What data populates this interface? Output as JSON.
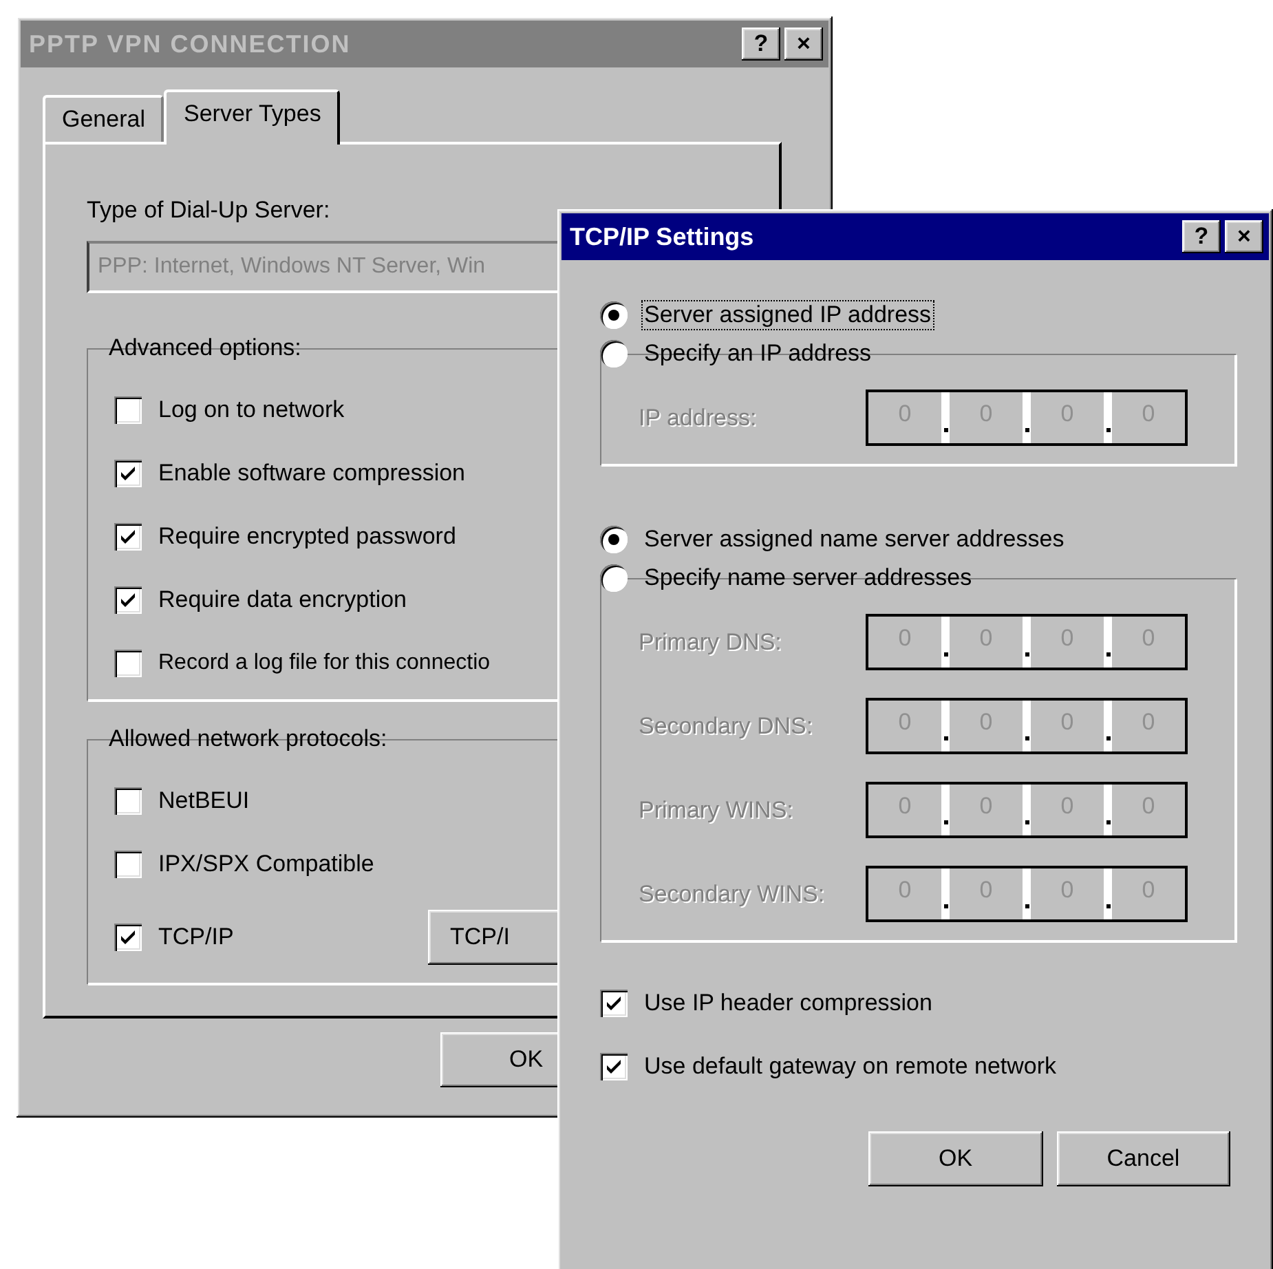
{
  "main_window": {
    "title": "PPTP VPN CONNECTION",
    "active": false,
    "title_buttons": [
      "?",
      "×"
    ],
    "tabs": [
      {
        "label": "General",
        "selected": false
      },
      {
        "label": "Server Types",
        "selected": true
      }
    ],
    "server_type": {
      "label": "Type of Dial-Up Server:",
      "value": "PPP: Internet, Windows NT Server, Win",
      "disabled": true
    },
    "groups": [
      {
        "title": "Advanced options:",
        "options": [
          {
            "label": "Log on to network",
            "checked": false
          },
          {
            "label": "Enable software compression",
            "checked": true
          },
          {
            "label": "Require encrypted password",
            "checked": true
          },
          {
            "label": "Require data encryption",
            "checked": true
          },
          {
            "label": "Record a log file for this connectio",
            "checked": false
          }
        ]
      },
      {
        "title": "Allowed network protocols:",
        "options": [
          {
            "label": "NetBEUI",
            "checked": false
          },
          {
            "label": "IPX/SPX Compatible",
            "checked": false
          },
          {
            "label": "TCP/IP",
            "checked": true
          }
        ],
        "button": "TCP/I"
      }
    ],
    "buttons": [
      "OK"
    ]
  },
  "tcpip_dialog": {
    "title": "TCP/IP Settings",
    "active": true,
    "title_buttons": [
      "?",
      "×"
    ],
    "sections": [
      {
        "choices": [
          {
            "label": "Server assigned IP address",
            "selected": true,
            "focused": true
          },
          {
            "label": "Specify an IP address",
            "selected": false,
            "focused": false
          }
        ],
        "fields": [
          {
            "label": "IP address:",
            "disabled": true,
            "octets": [
              "0",
              "0",
              "0",
              "0"
            ]
          }
        ]
      },
      {
        "choices": [
          {
            "label": "Server assigned name server addresses",
            "selected": true,
            "focused": false
          },
          {
            "label": "Specify name server addresses",
            "selected": false,
            "focused": false
          }
        ],
        "fields": [
          {
            "label": "Primary DNS:",
            "disabled": true,
            "octets": [
              "0",
              "0",
              "0",
              "0"
            ]
          },
          {
            "label": "Secondary DNS:",
            "disabled": true,
            "octets": [
              "0",
              "0",
              "0",
              "0"
            ]
          },
          {
            "label": "Primary WINS:",
            "disabled": true,
            "octets": [
              "0",
              "0",
              "0",
              "0"
            ]
          },
          {
            "label": "Secondary WINS:",
            "disabled": true,
            "octets": [
              "0",
              "0",
              "0",
              "0"
            ]
          }
        ]
      }
    ],
    "options": [
      {
        "label": "Use IP header compression",
        "checked": true
      },
      {
        "label": "Use default gateway on remote network",
        "checked": true
      }
    ],
    "buttons": [
      "OK",
      "Cancel"
    ]
  }
}
